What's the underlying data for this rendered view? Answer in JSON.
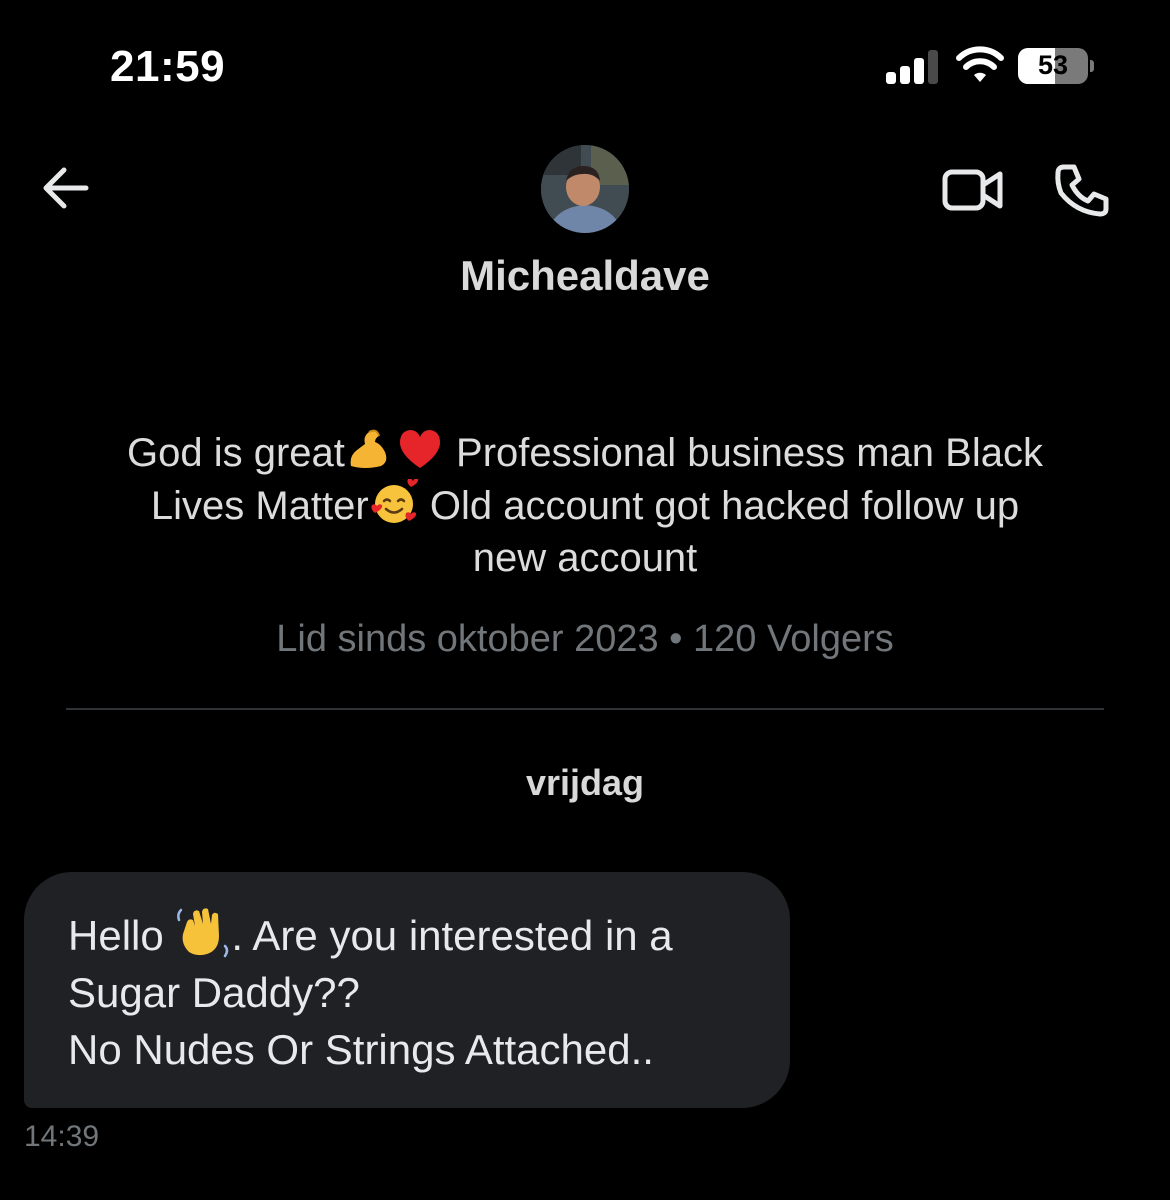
{
  "status_bar": {
    "time": "21:59",
    "battery": "53",
    "battery_level": 0.53,
    "signal_bars_active": 3,
    "signal_bars_total": 4
  },
  "header": {
    "display_name": "Michealdave",
    "icons": [
      "arrow-left-icon",
      "video-camera-icon",
      "phone-icon"
    ]
  },
  "profile": {
    "bio_lines": [
      {
        "before": "God is great",
        "after": " Professional business man Black"
      },
      {
        "before": "Lives Matter",
        "after": " Old account got hacked follow up"
      },
      {
        "text": "new account"
      }
    ],
    "bio_emojis": [
      "flexed-biceps",
      "red-heart",
      "smiling-face-with-hearts"
    ],
    "meta": "Lid sinds oktober 2023 • 120 Volgers"
  },
  "conversation": {
    "day_label": "vrijdag",
    "messages": [
      {
        "lines": [
          {
            "before": "Hello ",
            "after": ". Are you interested in a"
          },
          {
            "text": "Sugar Daddy??"
          },
          {
            "text": "No Nudes Or Strings Attached.."
          }
        ],
        "emoji": "waving-hand",
        "time": "14:39"
      }
    ]
  },
  "colors": {
    "background": "#000000",
    "bubble": "#1f2124",
    "muted_text": "#71767b",
    "primary_text": "#e7e9ea"
  }
}
